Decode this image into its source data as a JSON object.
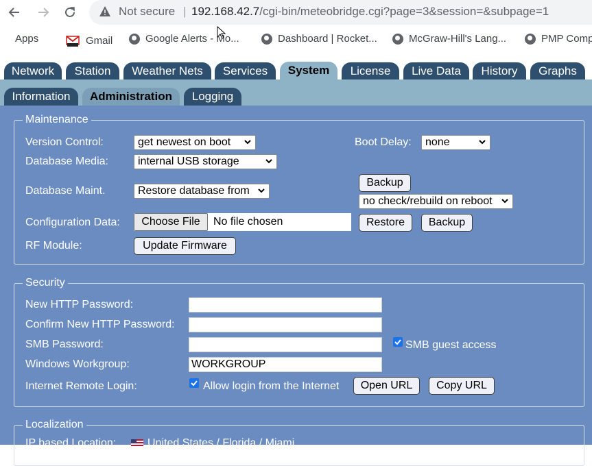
{
  "browser": {
    "not_secure": "Not secure",
    "url_host": "192.168.42.7",
    "url_path": "/cgi-bin/meteobridge.cgi?page=3&session=&subpage=1",
    "bookmarks": [
      {
        "label": "Apps",
        "icon": "apps-grid-icon"
      },
      {
        "label": "Gmail",
        "icon": "gmail-icon"
      },
      {
        "label": "Google Alerts - Mo...",
        "icon": "globe-icon"
      },
      {
        "label": "Dashboard | Rocket...",
        "icon": "globe-icon"
      },
      {
        "label": "McGraw-Hill's Lang...",
        "icon": "globe-icon"
      },
      {
        "label": "PMP Comp",
        "icon": "globe-icon"
      }
    ]
  },
  "tabs": [
    "Network",
    "Station",
    "Weather Nets",
    "Services",
    "System",
    "License",
    "Live Data",
    "History",
    "Graphs"
  ],
  "active_tab": "System",
  "subtabs": [
    "Information",
    "Administration",
    "Logging"
  ],
  "active_subtab": "Administration",
  "maintenance": {
    "legend": "Maintenance",
    "version_control_label": "Version Control:",
    "version_control_value": "get newest on boot",
    "boot_delay_label": "Boot Delay:",
    "boot_delay_value": "none",
    "database_media_label": "Database Media:",
    "database_media_value": "internal USB storage",
    "database_maint_label": "Database Maint.",
    "database_maint_value": "Restore database from",
    "database_backup_label": "Backup",
    "rebuild_value": "no check/rebuild on reboot",
    "config_data_label": "Configuration Data:",
    "choose_file_label": "Choose File",
    "no_file_text": "No file chosen",
    "restore_label": "Restore",
    "config_backup_label": "Backup",
    "rf_module_label": "RF Module:",
    "update_firmware_label": "Update Firmware"
  },
  "security": {
    "legend": "Security",
    "new_http_password_label": "New HTTP Password:",
    "confirm_http_password_label": "Confirm New HTTP Password:",
    "smb_password_label": "SMB Password:",
    "smb_guest_label": "SMB guest access",
    "workgroup_label": "Windows Workgroup:",
    "workgroup_value": "WORKGROUP",
    "remote_login_label": "Internet Remote Login:",
    "allow_login_label": "Allow login from the Internet",
    "open_url_label": "Open URL",
    "copy_url_label": "Copy URL"
  },
  "localization": {
    "legend": "Localization",
    "ip_location_label": "IP based Location:",
    "ip_location_value": "United States / Florida / Miami"
  },
  "colors": {
    "tab_dark": "#2e4f6e",
    "tab_active": "#8fb3c6",
    "panel_bg": "#6b8cc1",
    "checkbox_blue": "#1a73e8"
  }
}
